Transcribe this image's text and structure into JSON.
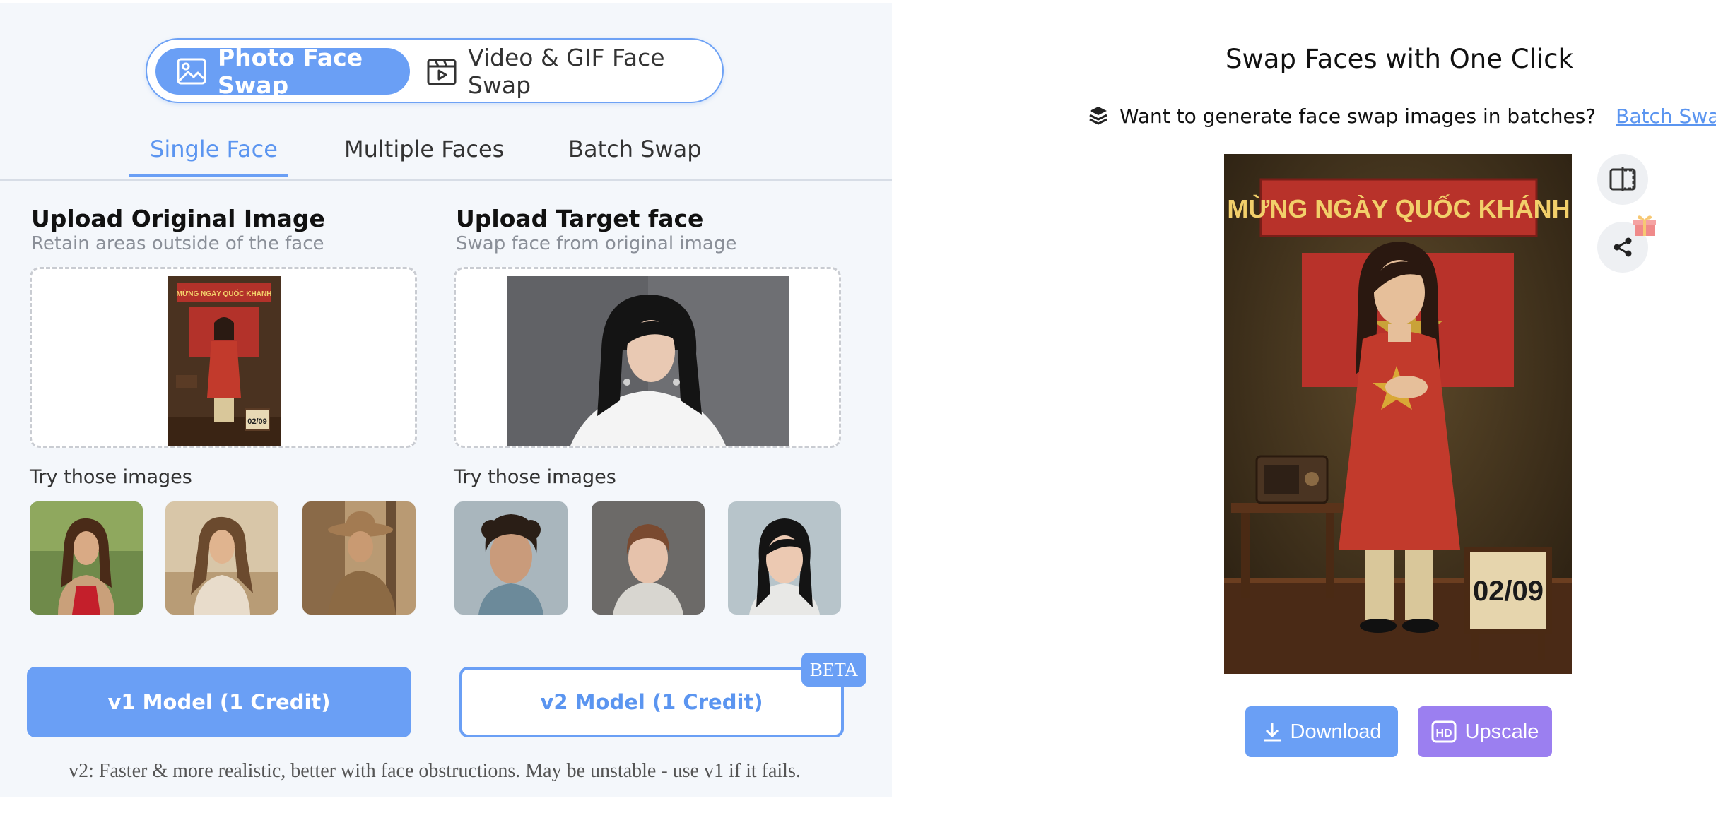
{
  "mode_toggle": {
    "photo_label": "Photo Face Swap",
    "video_label": "Video & GIF Face Swap"
  },
  "tabs": [
    {
      "label": "Single Face",
      "active": true
    },
    {
      "label": "Multiple Faces",
      "active": false
    },
    {
      "label": "Batch Swap",
      "active": false
    }
  ],
  "original": {
    "title": "Upload Original Image",
    "subtitle": "Retain areas outside of the face",
    "try_label": "Try those images",
    "banner_text": "MỪNG NGÀY QUỐC KHÁNH",
    "sign_text": "02/09"
  },
  "target": {
    "title": "Upload Target face",
    "subtitle": "Swap face from original image",
    "try_label": "Try those images"
  },
  "models": {
    "v1_label": "v1 Model (1 Credit)",
    "v2_label": "v2 Model (1 Credit)",
    "beta_badge": "BETA",
    "note": "v2: Faster & more realistic, better with face obstructions. May be unstable - use v1 if it fails."
  },
  "result": {
    "title": "Swap Faces with One Click",
    "batch_prompt": "Want to generate face swap images in batches?",
    "batch_link": "Batch Swap Now",
    "banner_text": "MỪNG NGÀY QUỐC KHÁNH",
    "sign_text": "02/09",
    "download_label": "Download",
    "upscale_label": "Upscale",
    "hd_badge": "HD"
  },
  "colors": {
    "accent": "#6a9ff5",
    "upscale": "#9b7ff0",
    "panel_bg": "#f4f7fb"
  }
}
